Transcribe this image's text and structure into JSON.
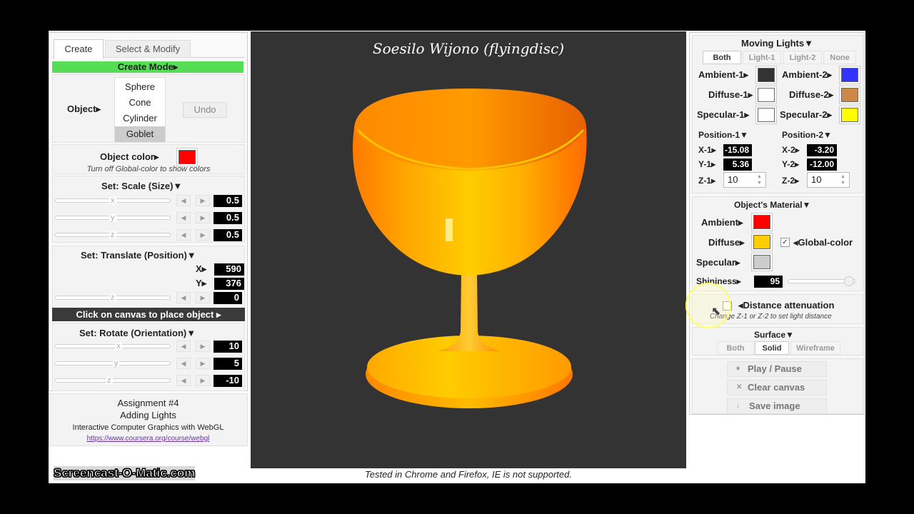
{
  "left": {
    "tabs": [
      "Create",
      "Select & Modify"
    ],
    "mode_bar": "Create Mode▸",
    "object_label": "Object▸",
    "objects": [
      "Sphere",
      "Cone",
      "Cylinder",
      "Goblet"
    ],
    "selected_object": "Goblet",
    "undo": "Undo",
    "object_color_label": "Object color▸",
    "object_color": "#ff0000",
    "object_color_hint": "Turn off Global-color to show colors",
    "scale": {
      "title": "Set: Scale (Size)▼",
      "axes": [
        "x",
        "y",
        "z"
      ],
      "values": [
        "0.5",
        "0.5",
        "0.5"
      ],
      "levels": [
        0.5,
        0.5,
        0.5
      ]
    },
    "translate": {
      "title": "Set: Translate (Position)▼",
      "x_label": "X▸",
      "x_value": "590",
      "y_label": "Y▸",
      "y_value": "376",
      "z_axis": "z",
      "z_value": "0",
      "z_level": 0.5
    },
    "place_bar": "Click on canvas to place object ▸",
    "rotate": {
      "title": "Set: Rotate (Orientation)▼",
      "axes": [
        "x",
        "y",
        "z"
      ],
      "values": [
        "10",
        "5",
        "-10"
      ],
      "levels": [
        0.55,
        0.53,
        0.47
      ]
    },
    "assignment": "Assignment #4",
    "assignment_sub": "Adding Lights",
    "course": "Interactive Computer Graphics with WebGL",
    "course_link": "https://www.coursera.org/course/webgl"
  },
  "canvas": {
    "title": "Soesilo Wijono (flyingdisc)",
    "footer_note": "Tested in Chrome and Firefox, IE is not supported."
  },
  "watermark": "Screencast-O-Matic.com",
  "right": {
    "lights_title": "Moving Lights▼",
    "light_tabs": [
      "Both",
      "Light-1",
      "Light-2",
      "None"
    ],
    "active_light_tab": "Both",
    "ambient1": "Ambient-1▸",
    "ambient2": "Ambient-2▸",
    "diffuse1": "Diffuse-1▸",
    "diffuse2": "Diffuse-2▸",
    "specular1": "Specular-1▸",
    "specular2": "Specular-2▸",
    "colors": {
      "ambient1": "#333333",
      "ambient2": "#3333ff",
      "diffuse1": "#ffffff",
      "diffuse2": "#cc8844",
      "specular1": "#ffffff",
      "specular2": "#ffff00"
    },
    "pos1": {
      "title": "Position-1▼",
      "x_label": "X-1▸",
      "x": "-15.08",
      "y_label": "Y-1▸",
      "y": "5.36",
      "z_label": "Z-1▸",
      "z": "10"
    },
    "pos2": {
      "title": "Position-2▼",
      "x_label": "X-2▸",
      "x": "-3.20",
      "y_label": "Y-2▸",
      "y": "-12.00",
      "z_label": "Z-2▸",
      "z": "10"
    },
    "material_title": "Object's Material▼",
    "ambient": "Ambient▸",
    "diffuse": "Diffuse▸",
    "specular": "Specular▸",
    "material_colors": {
      "ambient": "#ff0000",
      "diffuse": "#ffcc00",
      "specular": "#cccccc"
    },
    "global_color": "◂Global-color",
    "global_color_checked": true,
    "shininess_label": "Shininess▸",
    "shininess": "95",
    "shininess_level": 0.9,
    "distance": "◂Distance attenuation",
    "distance_hint": "Change Z-1 or Z-2 to set light distance",
    "surface_title": "Surface▼",
    "surface_tabs": [
      "Both",
      "Solid",
      "Wireframe"
    ],
    "active_surface": "Solid",
    "play": "Play / Pause",
    "clear": "Clear canvas",
    "save": "Save image",
    "play_icon": "pause-icon",
    "clear_icon": "close-icon",
    "save_icon": "down-arrow-icon"
  }
}
